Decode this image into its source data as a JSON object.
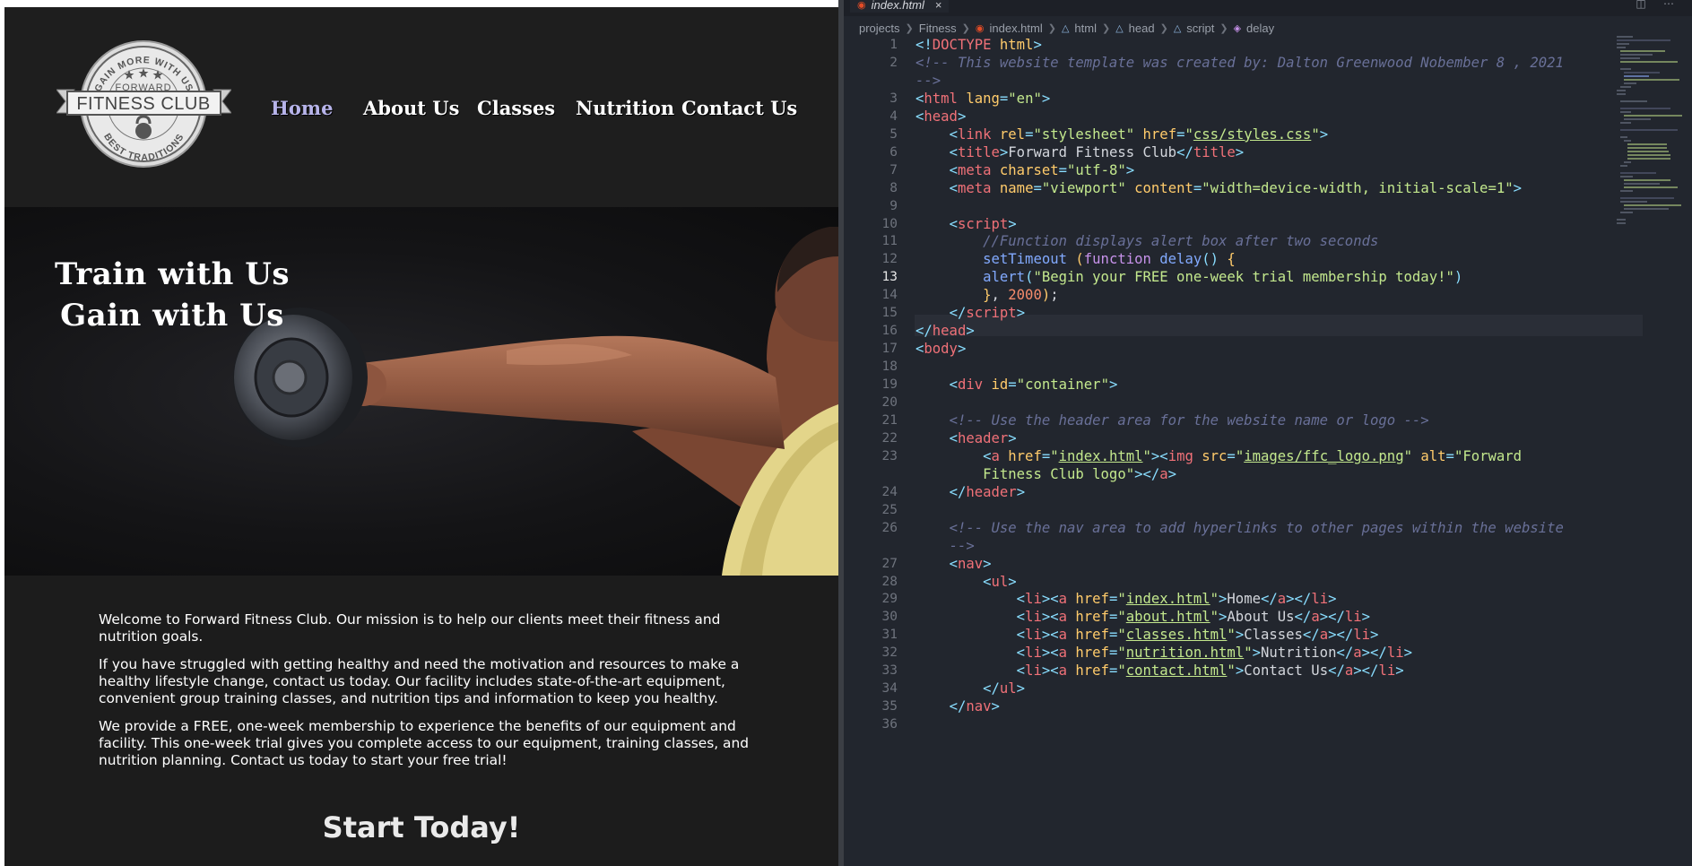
{
  "colors": {
    "accent_nav": "#b7b4ea",
    "site_bg": "#1c1c1c",
    "editor_bg": "#22262e"
  },
  "site": {
    "logo": {
      "top_arc": "GAIN MORE WITH US",
      "sub": "FORWARD",
      "name": "FITNESS CLUB",
      "bottom_arc": "BEST TRADITIONS",
      "icons": [
        "star-icon",
        "kettlebell-icon"
      ]
    },
    "nav": [
      "Home",
      "About Us",
      "Classes",
      "Nutrition",
      "Contact Us"
    ],
    "active_nav": "Home",
    "hero": {
      "line1": "Train with Us",
      "line2": "Gain with Us"
    },
    "paragraphs": [
      "Welcome to Forward Fitness Club. Our mission is to help our clients meet their fitness and nutrition goals.",
      "If you have struggled with getting healthy and need the motivation and resources to make a healthy lifestyle change, contact us today. Our facility includes state-of-the-art equipment, convenient group training classes, and nutrition tips and information to keep you healthy.",
      "We provide a FREE, one-week membership to experience the benefits of our equipment and facility. This one-week trial gives you complete access to our equipment, training classes, and nutrition planning. Contact us today to start your free trial!"
    ],
    "cta": "Start Today!"
  },
  "editor": {
    "tab": {
      "name": "index.html",
      "icon": "html5-icon",
      "close": "×"
    },
    "breadcrumbs": [
      "projects",
      "Fitness",
      "index.html",
      "html",
      "head",
      "script",
      "delay"
    ],
    "current_line": 13,
    "line_numbers": [
      "1",
      "2",
      "",
      "3",
      "4",
      "5",
      "6",
      "7",
      "8",
      "9",
      "10",
      "11",
      "12",
      "13",
      "14",
      "15",
      "16",
      "17",
      "18",
      "19",
      "20",
      "21",
      "22",
      "23",
      "",
      "24",
      "25",
      "26",
      "",
      "27",
      "28",
      "29",
      "30",
      "31",
      "32",
      "33",
      "34",
      "35",
      "36"
    ],
    "lines": [
      [
        [
          "t-br",
          "<!"
        ],
        [
          "t-tag",
          "DOCTYPE"
        ],
        [
          "t-txt",
          " "
        ],
        [
          "t-doc",
          "html"
        ],
        [
          "t-br",
          ">"
        ]
      ],
      [
        [
          "t-com",
          "<!-- This website template was created by: Dalton Greenwood Nobember 8 , 2021"
        ]
      ],
      [
        [
          "t-com",
          "-->"
        ]
      ],
      [
        [
          "t-br",
          "<"
        ],
        [
          "t-tag",
          "html"
        ],
        [
          "t-txt",
          " "
        ],
        [
          "t-attr",
          "lang"
        ],
        [
          "t-br",
          "="
        ],
        [
          "t-val",
          "\"en\""
        ],
        [
          "t-br",
          ">"
        ]
      ],
      [
        [
          "t-br",
          "<"
        ],
        [
          "t-tag",
          "head"
        ],
        [
          "t-br",
          ">"
        ]
      ],
      [
        [
          "t-txt",
          "    "
        ],
        [
          "t-br",
          "<"
        ],
        [
          "t-tag",
          "link"
        ],
        [
          "t-txt",
          " "
        ],
        [
          "t-attr",
          "rel"
        ],
        [
          "t-br",
          "="
        ],
        [
          "t-val",
          "\"stylesheet\""
        ],
        [
          "t-txt",
          " "
        ],
        [
          "t-attr",
          "href"
        ],
        [
          "t-br",
          "="
        ],
        [
          "t-val",
          "\""
        ],
        [
          "t-val t-u",
          "css/styles.css"
        ],
        [
          "t-val",
          "\""
        ],
        [
          "t-br",
          ">"
        ]
      ],
      [
        [
          "t-txt",
          "    "
        ],
        [
          "t-br",
          "<"
        ],
        [
          "t-tag",
          "title"
        ],
        [
          "t-br",
          ">"
        ],
        [
          "t-txt",
          "Forward Fitness Club"
        ],
        [
          "t-br",
          "</"
        ],
        [
          "t-tag",
          "title"
        ],
        [
          "t-br",
          ">"
        ]
      ],
      [
        [
          "t-txt",
          "    "
        ],
        [
          "t-br",
          "<"
        ],
        [
          "t-tag",
          "meta"
        ],
        [
          "t-txt",
          " "
        ],
        [
          "t-attr",
          "charset"
        ],
        [
          "t-br",
          "="
        ],
        [
          "t-val",
          "\"utf-8\""
        ],
        [
          "t-br",
          ">"
        ]
      ],
      [
        [
          "t-txt",
          "    "
        ],
        [
          "t-br",
          "<"
        ],
        [
          "t-tag",
          "meta"
        ],
        [
          "t-txt",
          " "
        ],
        [
          "t-attr",
          "name"
        ],
        [
          "t-br",
          "="
        ],
        [
          "t-val",
          "\"viewport\""
        ],
        [
          "t-txt",
          " "
        ],
        [
          "t-attr",
          "content"
        ],
        [
          "t-br",
          "="
        ],
        [
          "t-val",
          "\"width=device-width, initial-scale=1\""
        ],
        [
          "t-br",
          ">"
        ]
      ],
      [],
      [
        [
          "t-txt",
          "    "
        ],
        [
          "t-br",
          "<"
        ],
        [
          "t-tag",
          "script"
        ],
        [
          "t-br",
          ">"
        ]
      ],
      [
        [
          "t-txt",
          "        "
        ],
        [
          "t-com",
          "//Function displays alert box after two seconds"
        ]
      ],
      [
        [
          "t-txt",
          "        "
        ],
        [
          "t-fn",
          "setTimeout"
        ],
        [
          "t-txt",
          " "
        ],
        [
          "t-attr",
          "("
        ],
        [
          "t-kw",
          "function"
        ],
        [
          "t-txt",
          " "
        ],
        [
          "t-fn",
          "delay"
        ],
        [
          "t-br",
          "()"
        ],
        [
          "t-txt",
          " "
        ],
        [
          "t-attr",
          "{"
        ]
      ],
      [
        [
          "t-txt",
          "        "
        ],
        [
          "t-fn",
          "alert"
        ],
        [
          "t-br",
          "("
        ],
        [
          "t-val",
          "\"Begin your FREE one-week trial membership today!\""
        ],
        [
          "t-br",
          ")"
        ]
      ],
      [
        [
          "t-txt",
          "        "
        ],
        [
          "t-attr",
          "}"
        ],
        [
          "t-txt",
          ", "
        ],
        [
          "t-num",
          "2000"
        ],
        [
          "t-attr",
          ")"
        ],
        [
          "t-txt",
          ";"
        ]
      ],
      [
        [
          "t-txt",
          "    "
        ],
        [
          "t-br",
          "</"
        ],
        [
          "t-tag",
          "script"
        ],
        [
          "t-br",
          ">"
        ]
      ],
      [
        [
          "t-br",
          "</"
        ],
        [
          "t-tag",
          "head"
        ],
        [
          "t-br",
          ">"
        ]
      ],
      [
        [
          "t-br",
          "<"
        ],
        [
          "t-tag",
          "body"
        ],
        [
          "t-br",
          ">"
        ]
      ],
      [],
      [
        [
          "t-txt",
          "    "
        ],
        [
          "t-br",
          "<"
        ],
        [
          "t-tag",
          "div"
        ],
        [
          "t-txt",
          " "
        ],
        [
          "t-attr",
          "id"
        ],
        [
          "t-br",
          "="
        ],
        [
          "t-val",
          "\"container\""
        ],
        [
          "t-br",
          ">"
        ]
      ],
      [],
      [
        [
          "t-txt",
          "    "
        ],
        [
          "t-com",
          "<!-- Use the header area for the website name or logo -->"
        ]
      ],
      [
        [
          "t-txt",
          "    "
        ],
        [
          "t-br",
          "<"
        ],
        [
          "t-tag",
          "header"
        ],
        [
          "t-br",
          ">"
        ]
      ],
      [
        [
          "t-txt",
          "        "
        ],
        [
          "t-br",
          "<"
        ],
        [
          "t-tag",
          "a"
        ],
        [
          "t-txt",
          " "
        ],
        [
          "t-attr",
          "href"
        ],
        [
          "t-br",
          "="
        ],
        [
          "t-val",
          "\""
        ],
        [
          "t-val t-u",
          "index.html"
        ],
        [
          "t-val",
          "\""
        ],
        [
          "t-br",
          "><"
        ],
        [
          "t-tag",
          "img"
        ],
        [
          "t-txt",
          " "
        ],
        [
          "t-attr",
          "src"
        ],
        [
          "t-br",
          "="
        ],
        [
          "t-val",
          "\""
        ],
        [
          "t-val t-u",
          "images/ffc_logo.png"
        ],
        [
          "t-val",
          "\""
        ],
        [
          "t-txt",
          " "
        ],
        [
          "t-attr",
          "alt"
        ],
        [
          "t-br",
          "="
        ],
        [
          "t-val",
          "\"Forward"
        ]
      ],
      [
        [
          "t-txt",
          "        "
        ],
        [
          "t-val",
          "Fitness Club logo\""
        ],
        [
          "t-br",
          "></"
        ],
        [
          "t-tag",
          "a"
        ],
        [
          "t-br",
          ">"
        ]
      ],
      [
        [
          "t-txt",
          "    "
        ],
        [
          "t-br",
          "</"
        ],
        [
          "t-tag",
          "header"
        ],
        [
          "t-br",
          ">"
        ]
      ],
      [],
      [
        [
          "t-txt",
          "    "
        ],
        [
          "t-com",
          "<!-- Use the nav area to add hyperlinks to other pages within the website"
        ]
      ],
      [
        [
          "t-txt",
          "    "
        ],
        [
          "t-com",
          "-->"
        ]
      ],
      [
        [
          "t-txt",
          "    "
        ],
        [
          "t-br",
          "<"
        ],
        [
          "t-tag",
          "nav"
        ],
        [
          "t-br",
          ">"
        ]
      ],
      [
        [
          "t-txt",
          "        "
        ],
        [
          "t-br",
          "<"
        ],
        [
          "t-tag",
          "ul"
        ],
        [
          "t-br",
          ">"
        ]
      ],
      [
        [
          "t-txt",
          "            "
        ],
        [
          "t-br",
          "<"
        ],
        [
          "t-tag",
          "li"
        ],
        [
          "t-br",
          "><"
        ],
        [
          "t-tag",
          "a"
        ],
        [
          "t-txt",
          " "
        ],
        [
          "t-attr",
          "href"
        ],
        [
          "t-br",
          "="
        ],
        [
          "t-val",
          "\""
        ],
        [
          "t-val t-u",
          "index.html"
        ],
        [
          "t-val",
          "\""
        ],
        [
          "t-br",
          ">"
        ],
        [
          "t-txt",
          "Home"
        ],
        [
          "t-br",
          "</"
        ],
        [
          "t-tag",
          "a"
        ],
        [
          "t-br",
          "></"
        ],
        [
          "t-tag",
          "li"
        ],
        [
          "t-br",
          ">"
        ]
      ],
      [
        [
          "t-txt",
          "            "
        ],
        [
          "t-br",
          "<"
        ],
        [
          "t-tag",
          "li"
        ],
        [
          "t-br",
          "><"
        ],
        [
          "t-tag",
          "a"
        ],
        [
          "t-txt",
          " "
        ],
        [
          "t-attr",
          "href"
        ],
        [
          "t-br",
          "="
        ],
        [
          "t-val",
          "\""
        ],
        [
          "t-val t-u",
          "about.html"
        ],
        [
          "t-val",
          "\""
        ],
        [
          "t-br",
          ">"
        ],
        [
          "t-txt",
          "About Us"
        ],
        [
          "t-br",
          "</"
        ],
        [
          "t-tag",
          "a"
        ],
        [
          "t-br",
          "></"
        ],
        [
          "t-tag",
          "li"
        ],
        [
          "t-br",
          ">"
        ]
      ],
      [
        [
          "t-txt",
          "            "
        ],
        [
          "t-br",
          "<"
        ],
        [
          "t-tag",
          "li"
        ],
        [
          "t-br",
          "><"
        ],
        [
          "t-tag",
          "a"
        ],
        [
          "t-txt",
          " "
        ],
        [
          "t-attr",
          "href"
        ],
        [
          "t-br",
          "="
        ],
        [
          "t-val",
          "\""
        ],
        [
          "t-val t-u",
          "classes.html"
        ],
        [
          "t-val",
          "\""
        ],
        [
          "t-br",
          ">"
        ],
        [
          "t-txt",
          "Classes"
        ],
        [
          "t-br",
          "</"
        ],
        [
          "t-tag",
          "a"
        ],
        [
          "t-br",
          "></"
        ],
        [
          "t-tag",
          "li"
        ],
        [
          "t-br",
          ">"
        ]
      ],
      [
        [
          "t-txt",
          "            "
        ],
        [
          "t-br",
          "<"
        ],
        [
          "t-tag",
          "li"
        ],
        [
          "t-br",
          "><"
        ],
        [
          "t-tag",
          "a"
        ],
        [
          "t-txt",
          " "
        ],
        [
          "t-attr",
          "href"
        ],
        [
          "t-br",
          "="
        ],
        [
          "t-val",
          "\""
        ],
        [
          "t-val t-u",
          "nutrition.html"
        ],
        [
          "t-val",
          "\""
        ],
        [
          "t-br",
          ">"
        ],
        [
          "t-txt",
          "Nutrition"
        ],
        [
          "t-br",
          "</"
        ],
        [
          "t-tag",
          "a"
        ],
        [
          "t-br",
          "></"
        ],
        [
          "t-tag",
          "li"
        ],
        [
          "t-br",
          ">"
        ]
      ],
      [
        [
          "t-txt",
          "            "
        ],
        [
          "t-br",
          "<"
        ],
        [
          "t-tag",
          "li"
        ],
        [
          "t-br",
          "><"
        ],
        [
          "t-tag",
          "a"
        ],
        [
          "t-txt",
          " "
        ],
        [
          "t-attr",
          "href"
        ],
        [
          "t-br",
          "="
        ],
        [
          "t-val",
          "\""
        ],
        [
          "t-val t-u",
          "contact.html"
        ],
        [
          "t-val",
          "\""
        ],
        [
          "t-br",
          ">"
        ],
        [
          "t-txt",
          "Contact Us"
        ],
        [
          "t-br",
          "</"
        ],
        [
          "t-tag",
          "a"
        ],
        [
          "t-br",
          "></"
        ],
        [
          "t-tag",
          "li"
        ],
        [
          "t-br",
          ">"
        ]
      ],
      [
        [
          "t-txt",
          "        "
        ],
        [
          "t-br",
          "</"
        ],
        [
          "t-tag",
          "ul"
        ],
        [
          "t-br",
          ">"
        ]
      ],
      [
        [
          "t-txt",
          "    "
        ],
        [
          "t-br",
          "</"
        ],
        [
          "t-tag",
          "nav"
        ],
        [
          "t-br",
          ">"
        ]
      ],
      []
    ]
  }
}
